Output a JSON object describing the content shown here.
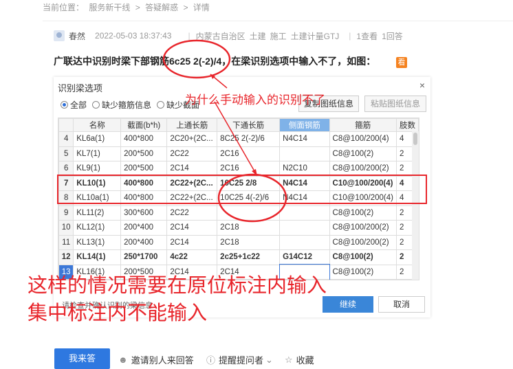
{
  "breadcrumb": {
    "current": "当前位置：",
    "crumbs": [
      "服务新干线",
      ">",
      "答疑解惑",
      ">",
      "详情"
    ]
  },
  "question": {
    "user": "春然",
    "time": "2022-05-03 18:37:43",
    "region": "内蒙古自治区",
    "tags": [
      "土建",
      "施工",
      "土建计量GTJ"
    ],
    "views": "1查看",
    "answers": "1回答",
    "title": "广联达中识别时梁下部钢筋6c25 2(-2)/4，在梁识别选项中输入不了，如图：",
    "image_badge": "看"
  },
  "dialog": {
    "title": "识别梁选项",
    "close": "×",
    "radios": [
      {
        "label": "全部",
        "checked": true
      },
      {
        "label": "缺少箍筋信息",
        "checked": false
      },
      {
        "label": "缺少截面",
        "checked": false
      }
    ],
    "copy_button": "复制图纸信息",
    "paste_button": "粘贴图纸信息",
    "columns": [
      "",
      "名称",
      "截面(b*h)",
      "上通长筋",
      "下通长筋",
      "侧面钢筋",
      "箍筋",
      "肢数"
    ],
    "rows": [
      {
        "n": "4",
        "cells": [
          "KL6a(1)",
          "400*800",
          "2C20+(2C...",
          "8C25 2(-2)/6",
          "N4C14",
          "C8@100/200(4)",
          "4"
        ],
        "bold": false
      },
      {
        "n": "5",
        "cells": [
          "KL7(1)",
          "200*500",
          "2C22",
          "2C16",
          "",
          "C8@100(2)",
          "2"
        ],
        "bold": false
      },
      {
        "n": "6",
        "cells": [
          "KL9(1)",
          "200*500",
          "2C14",
          "2C16",
          "N2C10",
          "C8@100/200(2)",
          "2"
        ],
        "bold": false
      },
      {
        "n": "7",
        "cells": [
          "KL10(1)",
          "400*800",
          "2C22+(2C...",
          "10C25 2/8",
          "N4C14",
          "C10@100/200(4)",
          "4"
        ],
        "bold": true
      },
      {
        "n": "8",
        "cells": [
          "KL10a(1)",
          "400*800",
          "2C22+(2C...",
          "10C25 4(-2)/6",
          "N4C14",
          "C10@100/200(4)",
          "4"
        ],
        "bold": false
      },
      {
        "n": "9",
        "cells": [
          "KL11(2)",
          "300*600",
          "2C22",
          "",
          "",
          "C8@100(2)",
          "2"
        ],
        "bold": false
      },
      {
        "n": "10",
        "cells": [
          "KL12(1)",
          "200*400",
          "2C14",
          "2C18",
          "",
          "C8@100/200(2)",
          "2"
        ],
        "bold": false
      },
      {
        "n": "11",
        "cells": [
          "KL13(1)",
          "200*400",
          "2C14",
          "2C18",
          "",
          "C8@100/200(2)",
          "2"
        ],
        "bold": false
      },
      {
        "n": "12",
        "cells": [
          "KL14(1)",
          "250*1700",
          "4c22",
          "2c25+1c22",
          "G14C12",
          "C8@100(2)",
          "2"
        ],
        "bold": true
      },
      {
        "n": "13",
        "cells": [
          "KL16(1)",
          "200*500",
          "2C14",
          "2C14",
          "",
          "C8@100(2)",
          "2"
        ],
        "bold": false,
        "selected": true
      }
    ],
    "footer_note": "请检查并确认识别的梁信息",
    "ok_button": "继续",
    "cancel_button": "取消"
  },
  "annotations": {
    "small_note": "为什么手动输入的识别不了",
    "big_note_line1": "这样的情况需要在原位标注内输入",
    "big_note_line2": "集中标注内不能输入",
    "color": "#e8252b"
  },
  "actions": {
    "answer": "我来答",
    "invite": "邀请别人来回答",
    "remind": "提醒提问者",
    "collect": "收藏"
  }
}
